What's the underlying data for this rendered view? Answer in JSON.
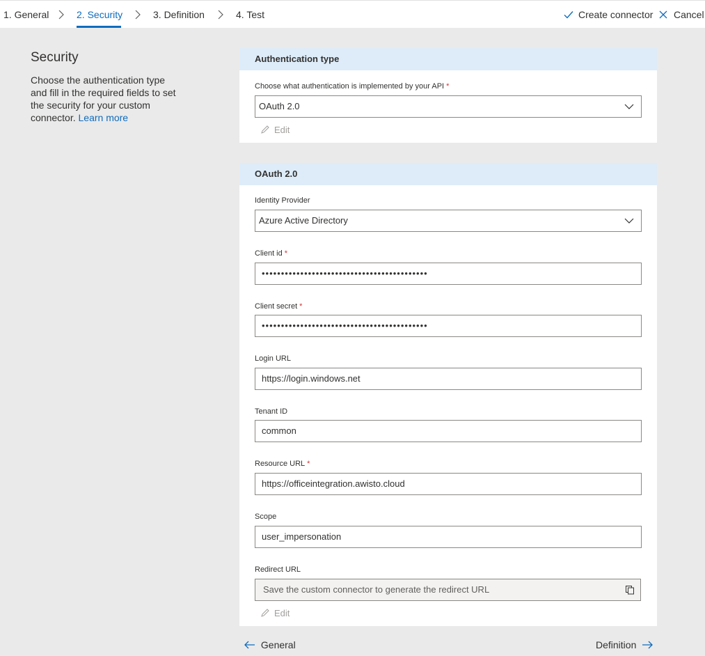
{
  "steps": [
    "1. General",
    "2. Security",
    "3. Definition",
    "4. Test"
  ],
  "actions": {
    "create": "Create connector",
    "cancel": "Cancel"
  },
  "sidebar": {
    "title": "Security",
    "description": "Choose the authentication type and fill in the required fields to set the security for your custom connector.",
    "learn_more": "Learn more"
  },
  "auth_card": {
    "header": "Authentication type",
    "label": "Choose what authentication is implemented by your API",
    "value": "OAuth 2.0",
    "edit": "Edit"
  },
  "oauth_card": {
    "header": "OAuth 2.0",
    "identity_provider": {
      "label": "Identity Provider",
      "value": "Azure Active Directory"
    },
    "client_id": {
      "label": "Client id",
      "value": "•••••••••••••••••••••••••••••••••••••••••••"
    },
    "client_secret": {
      "label": "Client secret",
      "value": "•••••••••••••••••••••••••••••••••••••••••••"
    },
    "login_url": {
      "label": "Login URL",
      "value": "https://login.windows.net"
    },
    "tenant_id": {
      "label": "Tenant ID",
      "value": "common"
    },
    "resource_url": {
      "label": "Resource URL",
      "value": "https://officeintegration.awisto.cloud"
    },
    "scope": {
      "label": "Scope",
      "value": "user_impersonation"
    },
    "redirect_url": {
      "label": "Redirect URL",
      "value": "Save the custom connector to generate the redirect URL"
    },
    "edit": "Edit"
  },
  "footer": {
    "back": "General",
    "next": "Definition"
  },
  "colors": {
    "accent": "#0f6cbd",
    "header_bg": "#deecf9",
    "required": "#d13438"
  },
  "required_marker": "*"
}
